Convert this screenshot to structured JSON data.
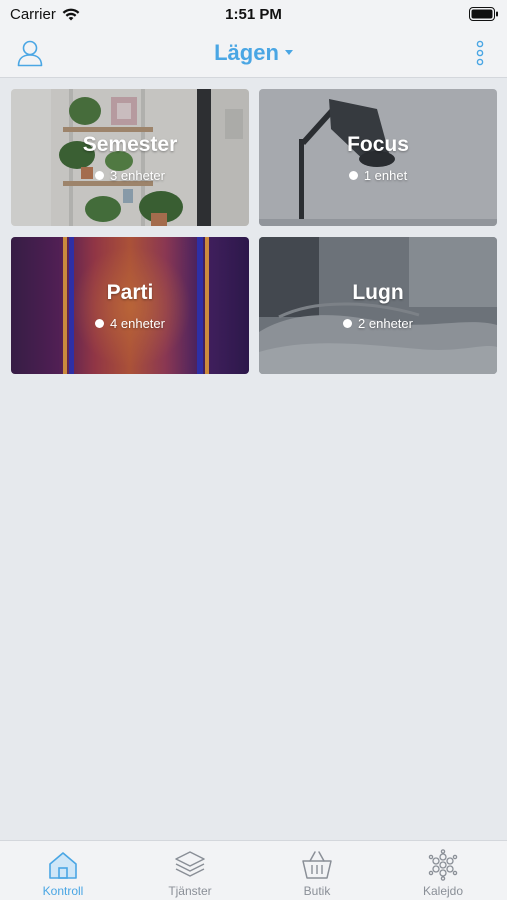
{
  "status_bar": {
    "carrier": "Carrier",
    "time": "1:51 PM"
  },
  "nav": {
    "title": "Lägen",
    "accent_color": "#4aa6e4"
  },
  "scenes": [
    {
      "name": "Semester",
      "devices": "3 enheter",
      "icon": "plants-photo"
    },
    {
      "name": "Focus",
      "devices": "1 enhet",
      "icon": "desk-lamp-photo"
    },
    {
      "name": "Parti",
      "devices": "4 enheter",
      "icon": "party-lights-photo"
    },
    {
      "name": "Lugn",
      "devices": "2 enheter",
      "icon": "bedroom-photo"
    }
  ],
  "tabs": [
    {
      "label": "Kontroll",
      "icon": "home-icon",
      "active": true
    },
    {
      "label": "Tjänster",
      "icon": "layers-icon",
      "active": false
    },
    {
      "label": "Butik",
      "icon": "basket-icon",
      "active": false
    },
    {
      "label": "Kalejdo",
      "icon": "kaleidoscope-icon",
      "active": false
    }
  ]
}
